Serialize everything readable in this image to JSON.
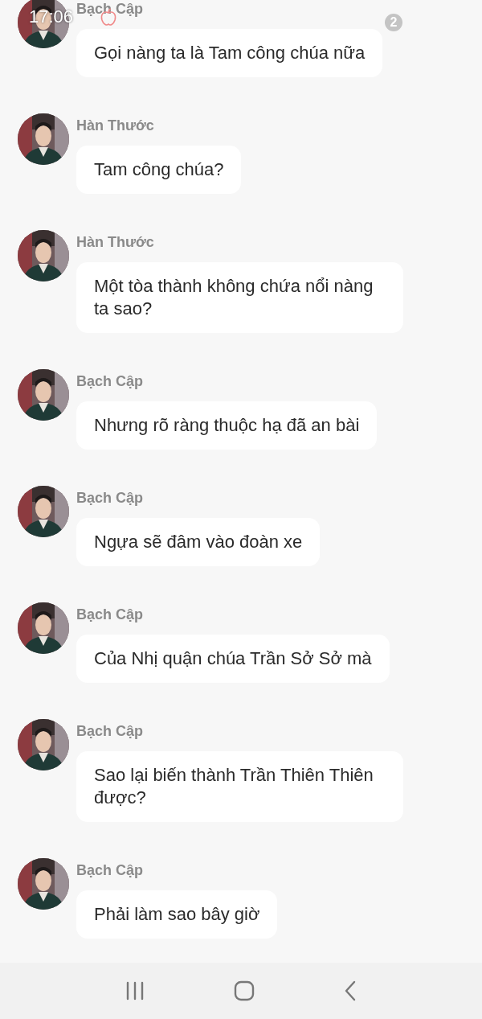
{
  "status_bar": {
    "time": "17:06",
    "badge": "2"
  },
  "messages": [
    {
      "sender": "Bạch Cập",
      "text": "Gọi nàng ta là Tam công chúa nữa"
    },
    {
      "sender": "Hàn Thước",
      "text": "Tam công chúa?"
    },
    {
      "sender": "Hàn Thước",
      "text": "Một tòa thành không chứa nổi nàng ta sao?"
    },
    {
      "sender": "Bạch Cập",
      "text": "Nhưng rõ ràng thuộc hạ đã an bài"
    },
    {
      "sender": "Bạch Cập",
      "text": "Ngựa sẽ đâm vào đoàn xe"
    },
    {
      "sender": "Bạch Cập",
      "text": "Của Nhị quận chúa Trần Sở Sở mà"
    },
    {
      "sender": "Bạch Cập",
      "text": "Sao lại biến thành Trần Thiên Thiên được?"
    },
    {
      "sender": "Bạch Cập",
      "text": "Phải làm sao bây giờ"
    }
  ]
}
